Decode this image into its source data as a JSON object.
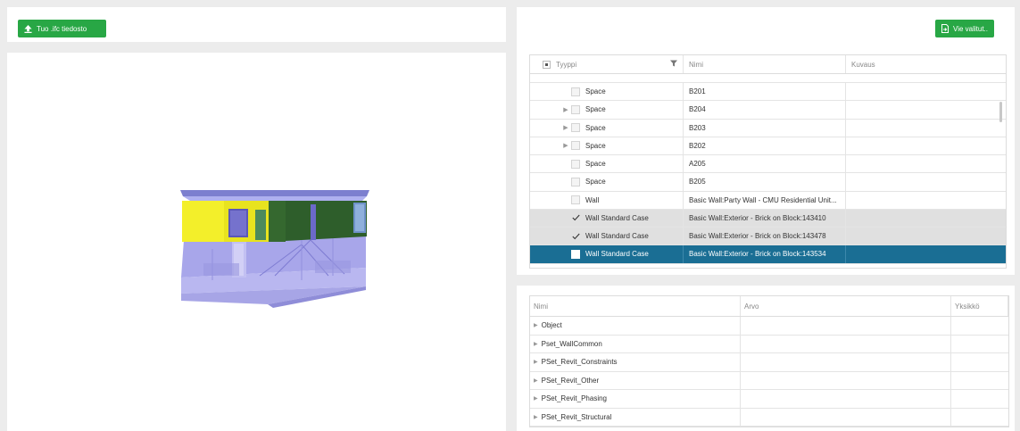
{
  "toolbar": {
    "import_label": "Tuo .ifc tiedosto",
    "import_icon": "upload-arrow-icon",
    "export_label": "Vie valitut..",
    "export_icon": "export-file-icon",
    "accent_color": "#28a745"
  },
  "tree": {
    "headers": {
      "type": "Tyyppi",
      "name": "Nimi",
      "description": "Kuvaus"
    },
    "rows": [
      {
        "type": "Space",
        "name": "B201",
        "desc": ""
      },
      {
        "type": "Space",
        "name": "B204",
        "desc": ""
      },
      {
        "type": "Space",
        "name": "B203",
        "desc": ""
      },
      {
        "type": "Space",
        "name": "B202",
        "desc": ""
      },
      {
        "type": "Space",
        "name": "A205",
        "desc": ""
      },
      {
        "type": "Space",
        "name": "B205",
        "desc": ""
      },
      {
        "type": "Wall",
        "name": "Basic Wall:Party Wall - CMU Residential Unit...",
        "desc": ""
      },
      {
        "type": "Wall Standard Case",
        "name": "Basic Wall:Exterior - Brick on Block:143410",
        "desc": ""
      },
      {
        "type": "Wall Standard Case",
        "name": "Basic Wall:Exterior - Brick on Block:143478",
        "desc": ""
      },
      {
        "type": "Wall Standard Case",
        "name": "Basic Wall:Exterior - Brick on Block:143534",
        "desc": ""
      }
    ],
    "active_row_color": "#1a6e94"
  },
  "properties": {
    "headers": {
      "name": "Nimi",
      "value": "Arvo",
      "unit": "Yksikkö"
    },
    "rows": [
      {
        "name": "Object"
      },
      {
        "name": "Pset_WallCommon"
      },
      {
        "name": "PSet_Revit_Constraints"
      },
      {
        "name": "PSet_Revit_Other"
      },
      {
        "name": "PSet_Revit_Phasing"
      },
      {
        "name": "PSet_Revit_Structural"
      }
    ]
  }
}
